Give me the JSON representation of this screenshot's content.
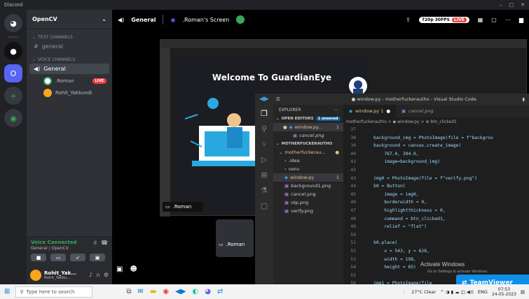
{
  "titlebar": {
    "app": "Discord",
    "controls": [
      "–",
      "□",
      "✕"
    ]
  },
  "server": {
    "name": "OpenCV"
  },
  "guilds": [
    {
      "icon": "discord-logo-icon"
    },
    {
      "label": "O"
    },
    {
      "icon": "plus-icon"
    },
    {
      "icon": "compass-icon"
    }
  ],
  "channels": {
    "text_category": "TEXT CHANNELS",
    "text": [
      {
        "label": "general"
      }
    ],
    "voice_category": "VOICE CHANNELS",
    "voice": [
      {
        "label": "General"
      }
    ],
    "users": [
      {
        "name": ".Roman",
        "badge": "LIVE"
      },
      {
        "name": "Rohit_Yakkundi"
      }
    ]
  },
  "voice_panel": {
    "status": "Voice Connected",
    "location": "General / OpenCV"
  },
  "user_bar": {
    "name": "Rohit_Yak...",
    "sub": "Rohit_Yakku..."
  },
  "top": {
    "channel": "General",
    "stream": ".Roman's Screen",
    "quality": "720p 30FPS",
    "live": "LIVE"
  },
  "guardian": {
    "title": "Welcome To GuardianEye"
  },
  "stream_labels": {
    "roman_tile": ".Roman",
    "roman_thumb": ".Roman"
  },
  "vscode": {
    "title": "● window.py - motherfuckerautho - Visual Studio Code",
    "explorer": "EXPLORER",
    "open_editors": "OPEN EDITORS",
    "unsaved": "1 unsaved",
    "open_files": [
      "window.py...",
      "cancel.png"
    ],
    "project": "MOTHERFUCKERAUTHO",
    "tree": [
      "motherfuckerau...",
      ".idea",
      "venv",
      "window.py",
      "background1.png",
      "cancel.png",
      "otp.png",
      "verify.png"
    ],
    "tabs": [
      "window.py 1",
      "cancel.png"
    ],
    "breadcrumb": "motherfuckerautho > ◆ window.py > ⊕ btn_clicked1",
    "lines": [
      {
        "n": "37",
        "t": ""
      },
      {
        "n": "38",
        "t": "    background_img = PhotoImage(file = f\"backgrou"
      },
      {
        "n": "39",
        "t": "    background = canvas.create_image("
      },
      {
        "n": "40",
        "t": "        767.0, 394.0,"
      },
      {
        "n": "41",
        "t": "        image=background_img)"
      },
      {
        "n": "42",
        "t": ""
      },
      {
        "n": "43",
        "t": "    img0 = PhotoImage(file = f\"verify.png\")"
      },
      {
        "n": "44",
        "t": "    b0 = Button("
      },
      {
        "n": "45",
        "t": "        image = img0,"
      },
      {
        "n": "46",
        "t": "        borderwidth = 0,"
      },
      {
        "n": "47",
        "t": "        highlightthickness = 0,"
      },
      {
        "n": "48",
        "t": "        command = btn_clicked1,"
      },
      {
        "n": "49",
        "t": "        relief = \"flat\")"
      },
      {
        "n": "50",
        "t": ""
      },
      {
        "n": "51",
        "t": "    b0.place("
      },
      {
        "n": "52",
        "t": "        x = 543, y = 628,"
      },
      {
        "n": "53",
        "t": "        width = 198,"
      },
      {
        "n": "54",
        "t": "        height = 65)"
      },
      {
        "n": "55",
        "t": ""
      },
      {
        "n": "56",
        "t": "    img1 = PhotoImage(file"
      }
    ]
  },
  "watermark": {
    "line1": "Activate Windows",
    "line2": "Go to Settings to activate Windows."
  },
  "teamviewer": "TeamViewer",
  "taskbar": {
    "search": "Type here to search",
    "weather": "27°C  Clear",
    "lang": "ENG",
    "time": "07:53",
    "date": "24-05-2023"
  }
}
